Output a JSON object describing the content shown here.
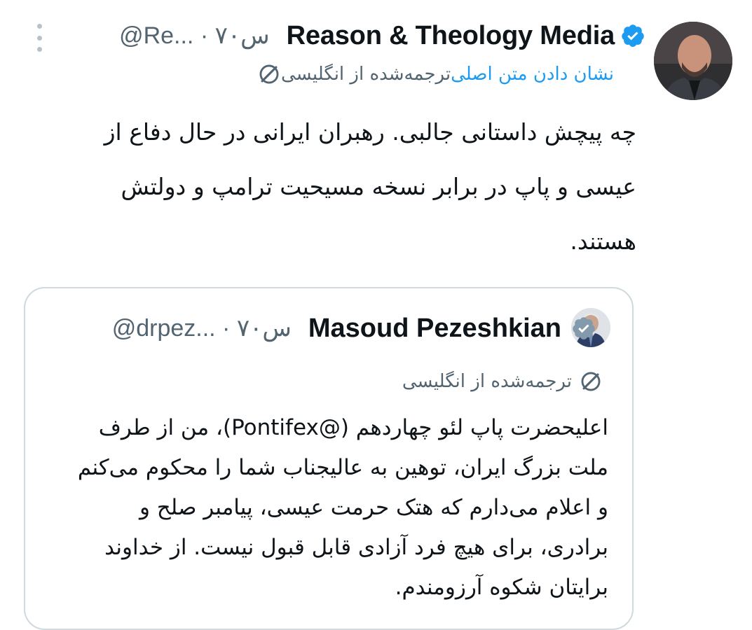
{
  "post": {
    "author": {
      "display_name": "Reason & Theology Media",
      "meta": "@Re... · ۷۰س",
      "verified_icon": "verified-badge-icon",
      "avatar_icon": "avatar"
    },
    "more_icon": "more-options-icon",
    "translation": {
      "icon": "translate-icon",
      "label": "ترجمه‌شده از انگلیسی",
      "show_original": "نشان دادن متن اصلی"
    },
    "text": "چه پیچش داستانی جالبی. رهبران ایرانی در حال دفاع از عیسی و پاپ در برابر نسخه مسیحیت ترامپ و دولتش هستند."
  },
  "quote": {
    "author": {
      "display_name": "Masoud Pezeshkian",
      "meta": "@drpez... · ۷۰س",
      "verified_icon": "verified-badge-icon"
    },
    "translation": {
      "icon": "translate-icon",
      "label": "ترجمه‌شده از انگلیسی"
    },
    "text": "اعلیحضرت پاپ لئو چهاردهم (@Pontifex)، من از طرف ملت بزرگ ایران، توهین به عالیجناب شما را محکوم می‌کنم و اعلام می‌دارم که هتک حرمت عیسی، پیامبر صلح و برادری، برای هیچ فرد آزادی قابل قبول نیست. از خداوند برایتان شکوه آرزومندم."
  },
  "colors": {
    "text": "#0f1419",
    "secondary": "#536471",
    "link": "#1d9bf0",
    "border": "#cfd9de",
    "verified": "#1d9bf0",
    "verified_gray": "#829aab"
  }
}
